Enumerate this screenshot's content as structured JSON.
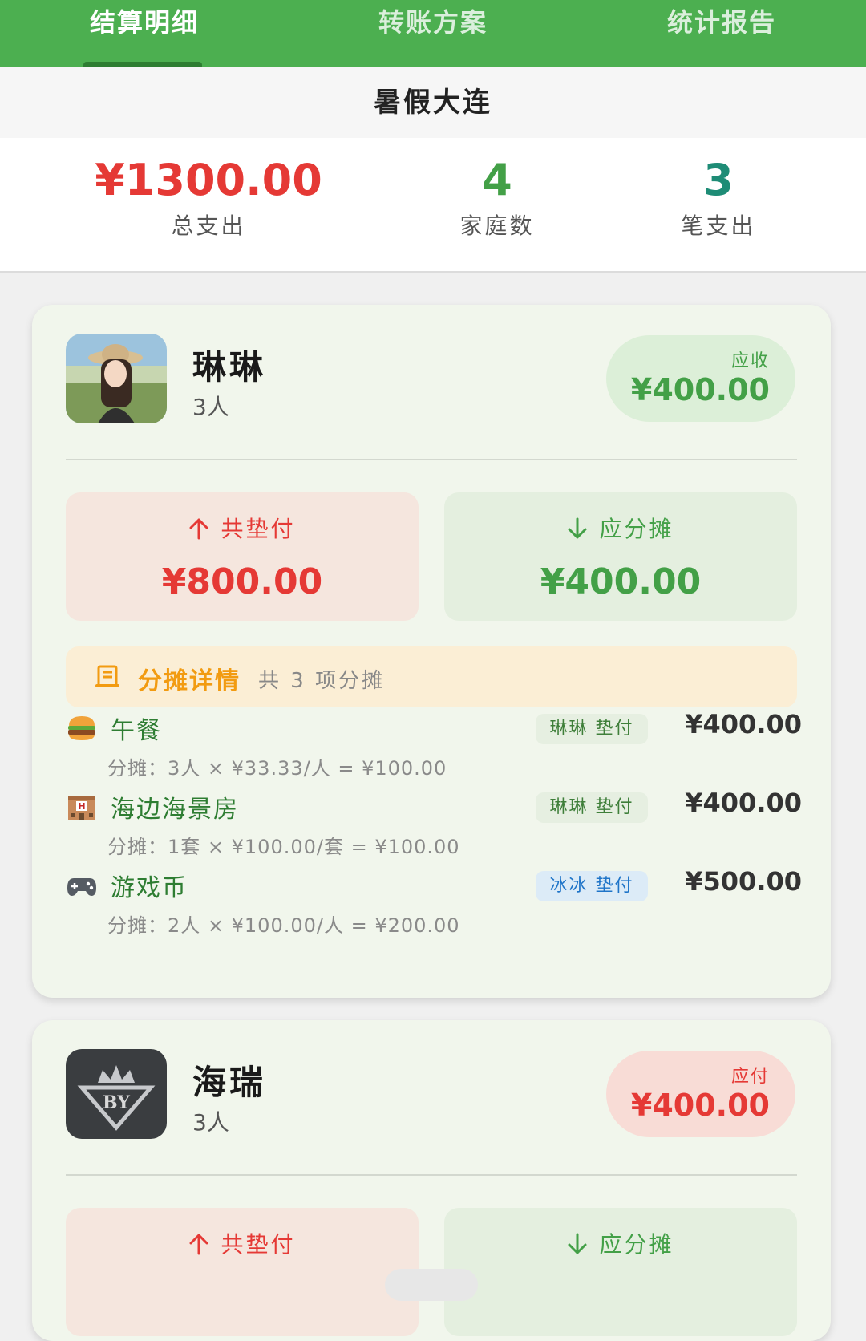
{
  "tabs": [
    {
      "label": "结算明细"
    },
    {
      "label": "转账方案"
    },
    {
      "label": "统计报告"
    }
  ],
  "trip_title": "暑假大连",
  "summary": {
    "total_expense": {
      "value": "¥1300.00",
      "label": "总支出"
    },
    "families": {
      "value": "4",
      "label": "家庭数"
    },
    "expense_count": {
      "value": "3",
      "label": "笔支出"
    }
  },
  "families": [
    {
      "name": "琳琳",
      "members": "3人",
      "status_label": "应收",
      "status_amount": "¥400.00",
      "paid_label": "共垫付",
      "paid_amount": "¥800.00",
      "share_label": "应分摊",
      "share_amount": "¥400.00",
      "detail_title": "分摊详情",
      "detail_count": "共 3 项分摊",
      "items": [
        {
          "icon": "hamburger-icon",
          "name": "午餐",
          "payer": "琳琳 垫付",
          "amount": "¥400.00",
          "formula": "分摊：3人 × ¥33.33/人 = ¥100.00"
        },
        {
          "icon": "hotel-icon",
          "name": "海边海景房",
          "payer": "琳琳 垫付",
          "amount": "¥400.00",
          "formula": "分摊：1套 × ¥100.00/套 = ¥100.00"
        },
        {
          "icon": "gamepad-icon",
          "name": "游戏币",
          "payer": "冰冰 垫付",
          "amount": "¥500.00",
          "formula": "分摊：2人 × ¥100.00/人 = ¥200.00"
        }
      ]
    },
    {
      "name": "海瑞",
      "members": "3人",
      "status_label": "应付",
      "status_amount": "¥400.00",
      "paid_label": "共垫付",
      "share_label": "应分摊"
    }
  ],
  "colors": {
    "brand_green": "#4caf50",
    "positive": "#43a047",
    "negative": "#e53935",
    "teal": "#1e8c76",
    "orange": "#f29b11"
  }
}
